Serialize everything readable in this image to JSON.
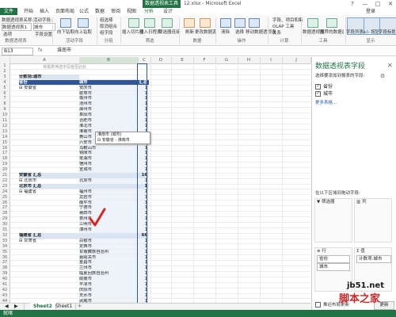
{
  "window": {
    "context_tab": "数据透视表工具",
    "title": "12.xlsx - Microsoft Excel",
    "help": "?",
    "minimize": "—",
    "restore": "□",
    "close": "✕"
  },
  "ribbon_tabs": [
    "文件",
    "开始",
    "插入",
    "页面布局",
    "公式",
    "数据",
    "审阅",
    "视图",
    "分析",
    "设计"
  ],
  "user": "登录",
  "ribbon": {
    "pivot_name_label": "数据透视表名称:",
    "pivot_name": "数据透视表1",
    "options_label": "选项",
    "active_field_label": "活动字段:",
    "active_field": "城市",
    "field_settings": "字段设置",
    "drill_down": "向下钻取",
    "drill_up": "向上钻取",
    "group_selection": "组选择",
    "ungroup": "取消组合",
    "group_field": "组字段",
    "insert_slicer": "插入切片器",
    "insert_timeline": "插入日程表",
    "filter_connections": "筛选器连接",
    "refresh": "刷新",
    "change_source": "更改数据源",
    "clear": "清除",
    "select": "选择",
    "move_pivot": "移动数据透视表",
    "fields_items": "字段、项目和集",
    "olap_tools": "OLAP 工具",
    "relationships": "关系",
    "pivot_chart": "数据透视图",
    "recommended_pivot": "推荐的数据透视表",
    "field_list": "字段列表",
    "plus_minus": "+/- 按钮",
    "field_headers": "字段标题",
    "groups": [
      "数据透视表",
      "活动字段",
      "分组",
      "筛选",
      "数据",
      "操作",
      "计算",
      "工具",
      "显示"
    ]
  },
  "formula_bar": {
    "name_box": "B13",
    "fx": "fx",
    "formula": "淮南市"
  },
  "columns": [
    "A",
    "B",
    "C",
    "D",
    "E",
    "F",
    "G",
    "H",
    "I",
    "J"
  ],
  "grid": {
    "top_caption": "将报表筛选字段拖至此处",
    "rows": [
      {
        "n": "1",
        "a": "",
        "b": "",
        "c": "",
        "t": "plain"
      },
      {
        "n": "2",
        "a": "",
        "b": "",
        "c": "",
        "t": "plain"
      },
      {
        "n": "3",
        "a": "计数项:城市",
        "b": "",
        "c": "",
        "t": "pv"
      },
      {
        "n": "4",
        "a": "省份",
        "b": "城市",
        "c": "汇总",
        "t": "hdr"
      },
      {
        "n": "5",
        "a": "⊟ 安徽省",
        "b": "安庆市",
        "c": "1",
        "t": "inner"
      },
      {
        "n": "6",
        "a": "",
        "b": "蚌埠市",
        "c": "1",
        "t": "inner"
      },
      {
        "n": "7",
        "a": "",
        "b": "亳州市",
        "c": "1",
        "t": "inner"
      },
      {
        "n": "8",
        "a": "",
        "b": "池州市",
        "c": "1",
        "t": "inner"
      },
      {
        "n": "9",
        "a": "",
        "b": "滁州市",
        "c": "1",
        "t": "inner"
      },
      {
        "n": "10",
        "a": "",
        "b": "阜阳市",
        "c": "1",
        "t": "inner"
      },
      {
        "n": "11",
        "a": "",
        "b": "合肥市",
        "c": "1",
        "t": "inner"
      },
      {
        "n": "12",
        "a": "",
        "b": "淮北市",
        "c": "1",
        "t": "inner"
      },
      {
        "n": "13",
        "a": "",
        "b": "淮南市",
        "c": "1",
        "t": "inner"
      },
      {
        "n": "14",
        "a": "",
        "b": "黄山市",
        "c": "1",
        "t": "inner"
      },
      {
        "n": "15",
        "a": "",
        "b": "六安市",
        "c": "1",
        "t": "inner"
      },
      {
        "n": "16",
        "a": "",
        "b": "马鞍山市",
        "c": "1",
        "t": "inner"
      },
      {
        "n": "17",
        "a": "",
        "b": "铜陵市",
        "c": "1",
        "t": "inner"
      },
      {
        "n": "18",
        "a": "",
        "b": "芜湖市",
        "c": "1",
        "t": "inner"
      },
      {
        "n": "19",
        "a": "",
        "b": "宿州市",
        "c": "1",
        "t": "inner"
      },
      {
        "n": "20",
        "a": "",
        "b": "宣城市",
        "c": "1",
        "t": "inner"
      },
      {
        "n": "21",
        "a": "安徽省 汇总",
        "b": "",
        "c": "16",
        "t": "total"
      },
      {
        "n": "22",
        "a": "⊟ 北京市",
        "b": "北京市",
        "c": "1",
        "t": "inner"
      },
      {
        "n": "23",
        "a": "北京市 汇总",
        "b": "",
        "c": "1",
        "t": "total"
      },
      {
        "n": "24",
        "a": "⊟ 福建省",
        "b": "福州市",
        "c": "1",
        "t": "inner"
      },
      {
        "n": "25",
        "a": "",
        "b": "龙岩市",
        "c": "1",
        "t": "inner"
      },
      {
        "n": "26",
        "a": "",
        "b": "南平市",
        "c": "1",
        "t": "inner"
      },
      {
        "n": "27",
        "a": "",
        "b": "宁德市",
        "c": "1",
        "t": "inner"
      },
      {
        "n": "28",
        "a": "",
        "b": "莆田市",
        "c": "1",
        "t": "inner"
      },
      {
        "n": "29",
        "a": "",
        "b": "泉州市",
        "c": "1",
        "t": "inner"
      },
      {
        "n": "30",
        "a": "",
        "b": "三明市",
        "c": "1",
        "t": "inner"
      },
      {
        "n": "31",
        "a": "",
        "b": "漳州市",
        "c": "1",
        "t": "inner"
      },
      {
        "n": "32",
        "a": "福建省 汇总",
        "b": "",
        "c": "66",
        "t": "total"
      },
      {
        "n": "33",
        "a": "⊟ 甘肃省",
        "b": "白银市",
        "c": "1",
        "t": "inner"
      },
      {
        "n": "34",
        "a": "",
        "b": "定西市",
        "c": "1",
        "t": "inner"
      },
      {
        "n": "35",
        "a": "",
        "b": "甘南藏族自治州",
        "c": "1",
        "t": "inner"
      },
      {
        "n": "36",
        "a": "",
        "b": "嘉峪关市",
        "c": "1",
        "t": "inner"
      },
      {
        "n": "37",
        "a": "",
        "b": "金昌市",
        "c": "1",
        "t": "inner"
      },
      {
        "n": "38",
        "a": "",
        "b": "兰州市",
        "c": "1",
        "t": "inner"
      },
      {
        "n": "39",
        "a": "",
        "b": "临夏回族自治州",
        "c": "1",
        "t": "inner"
      },
      {
        "n": "40",
        "a": "",
        "b": "陇南市",
        "c": "1",
        "t": "inner"
      },
      {
        "n": "41",
        "a": "",
        "b": "平凉市",
        "c": "1",
        "t": "inner"
      },
      {
        "n": "42",
        "a": "",
        "b": "庆阳市",
        "c": "1",
        "t": "inner"
      },
      {
        "n": "43",
        "a": "",
        "b": "天水市",
        "c": "1",
        "t": "inner"
      },
      {
        "n": "44",
        "a": "",
        "b": "武威市",
        "c": "1",
        "t": "inner"
      }
    ]
  },
  "tooltip": {
    "line1": "淮南市 (城市)",
    "line2": "⊟ 安徽省 - 淮南市"
  },
  "sheets": [
    "Sheet2",
    "Sheet1"
  ],
  "sheet_add": "+",
  "status": "就绪",
  "panel": {
    "title": "数据透视表字段",
    "close": "✕",
    "subtitle": "选择要添加到报表的字段:",
    "gear": "⚙",
    "fields": [
      {
        "label": "省份",
        "checked": "✓"
      },
      {
        "label": "城市",
        "checked": "✓"
      }
    ],
    "more_tables": "更多表格...",
    "drag_label": "在以下区域间拖动字段:",
    "zone_filters": "筛选器",
    "zone_columns": "列",
    "zone_rows": "行",
    "zone_values": "值",
    "row_chip_1": "省份",
    "row_chip_2": "城市",
    "value_chip": "计数项:城市",
    "defer": "推迟布局更新",
    "update": "更新"
  },
  "watermark": {
    "line1": "jb51.net",
    "line2": "脚本之家"
  }
}
